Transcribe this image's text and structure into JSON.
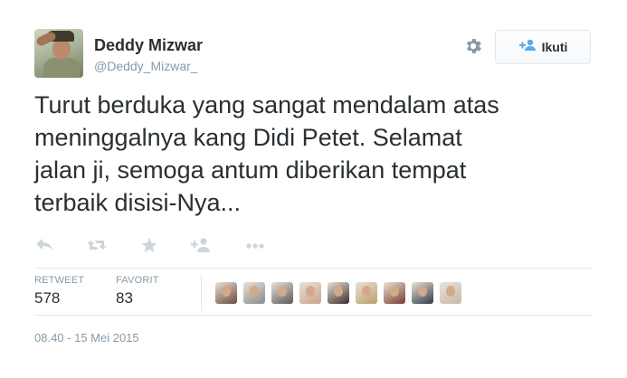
{
  "user": {
    "name": "Deddy Mizwar",
    "handle": "@Deddy_Mizwar_"
  },
  "follow_button": {
    "label": "Ikuti",
    "icon": "add-user-icon"
  },
  "menu": {
    "icon": "gear-icon"
  },
  "tweet": {
    "lines": [
      "Turut berduka yang sangat mendalam atas",
      "meninggalnya kang Didi Petet. Selamat",
      "jalan ji, semoga antum diberikan tempat",
      "terbaik disisi-Nya..."
    ]
  },
  "actions": [
    {
      "name": "reply-icon"
    },
    {
      "name": "retweet-icon"
    },
    {
      "name": "favorite-icon"
    },
    {
      "name": "follow-icon"
    },
    {
      "name": "more-icon"
    }
  ],
  "stats": {
    "retweet_label": "RETWEET",
    "retweet_count": "578",
    "favorite_label": "FAVORIT",
    "favorite_count": "83"
  },
  "favoriter_avatars": [
    {
      "color": "#6b4a3a"
    },
    {
      "color": "#8a8a8a"
    },
    {
      "color": "#5a5a5a"
    },
    {
      "color": "#c9a48a"
    },
    {
      "color": "#3d2b2b"
    },
    {
      "color": "#b7a06a"
    },
    {
      "color": "#7a3b2e"
    },
    {
      "color": "#2f3b4c"
    },
    {
      "color": "#c8b8a8"
    }
  ],
  "timestamp": "08.40 - 15 Mei 2015",
  "colors": {
    "text": "#292f33",
    "muted": "#8899a6",
    "action_icon": "#ccd6dd",
    "border": "#e1e8ed"
  }
}
